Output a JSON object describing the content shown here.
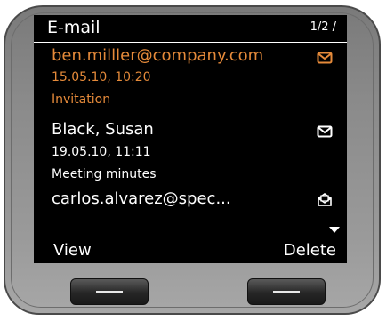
{
  "header": {
    "title": "E-mail",
    "page_indicator": "1/2 /"
  },
  "messages": [
    {
      "sender": "ben.milller@company.com",
      "datetime": "15.05.10, 10:20",
      "subject": "Invitation",
      "selected": true,
      "icon": "envelope-icon"
    },
    {
      "sender": "Black, Susan",
      "datetime": "19.05.10, 11:11",
      "subject": "Meeting minutes",
      "selected": false,
      "icon": "envelope-icon"
    },
    {
      "sender": "carlos.alvarez@spec...",
      "selected": false,
      "icon": "open-envelope-icon"
    }
  ],
  "softkeys": {
    "left": "View",
    "right": "Delete"
  },
  "colors": {
    "accent": "#e58a3a",
    "screen_bg": "#000000",
    "text": "#ffffff"
  }
}
